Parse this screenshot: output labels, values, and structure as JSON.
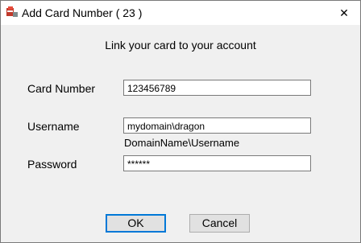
{
  "window": {
    "title": "Add Card Number ( 23 )",
    "close_glyph": "✕"
  },
  "form": {
    "header": "Link your card to your account",
    "card_number": {
      "label": "Card Number",
      "value": "123456789"
    },
    "username": {
      "label": "Username",
      "value": "mydomain\\dragon",
      "hint": "DomainName\\Username"
    },
    "password": {
      "label": "Password",
      "value": "******"
    }
  },
  "buttons": {
    "ok": "OK",
    "cancel": "Cancel"
  },
  "icons": {
    "app": "app-icon",
    "close": "close-icon"
  }
}
